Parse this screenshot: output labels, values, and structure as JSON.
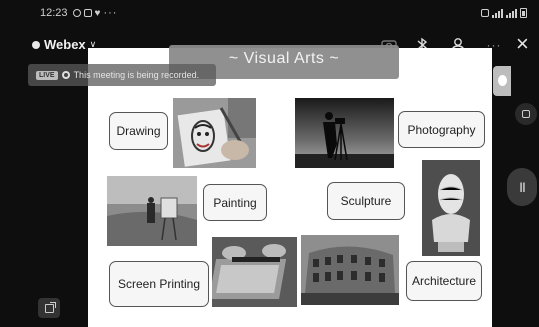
{
  "status_bar": {
    "time": "12:23",
    "more": "···"
  },
  "app": {
    "name": "Webex",
    "chevron": "∨"
  },
  "toolbar": {
    "more_label": "···",
    "close_label": "×"
  },
  "recording": {
    "badge": "LIVE",
    "message": "This meeting is being recorded."
  },
  "slide": {
    "title": "~ Visual Arts ~",
    "labels": {
      "drawing": "Drawing",
      "photography": "Photography",
      "painting": "Painting",
      "sculpture": "Sculpture",
      "screen_printing": "Screen Printing",
      "architecture": "Architecture"
    }
  },
  "controls": {
    "pause_label": "II"
  },
  "icons": [
    "bluetooth-icon",
    "person-icon",
    "camera-icon",
    "share-icon"
  ],
  "colors": {
    "background": "#0e0e0e",
    "slide": "#ffffff",
    "banner": "#8a8a8a"
  }
}
